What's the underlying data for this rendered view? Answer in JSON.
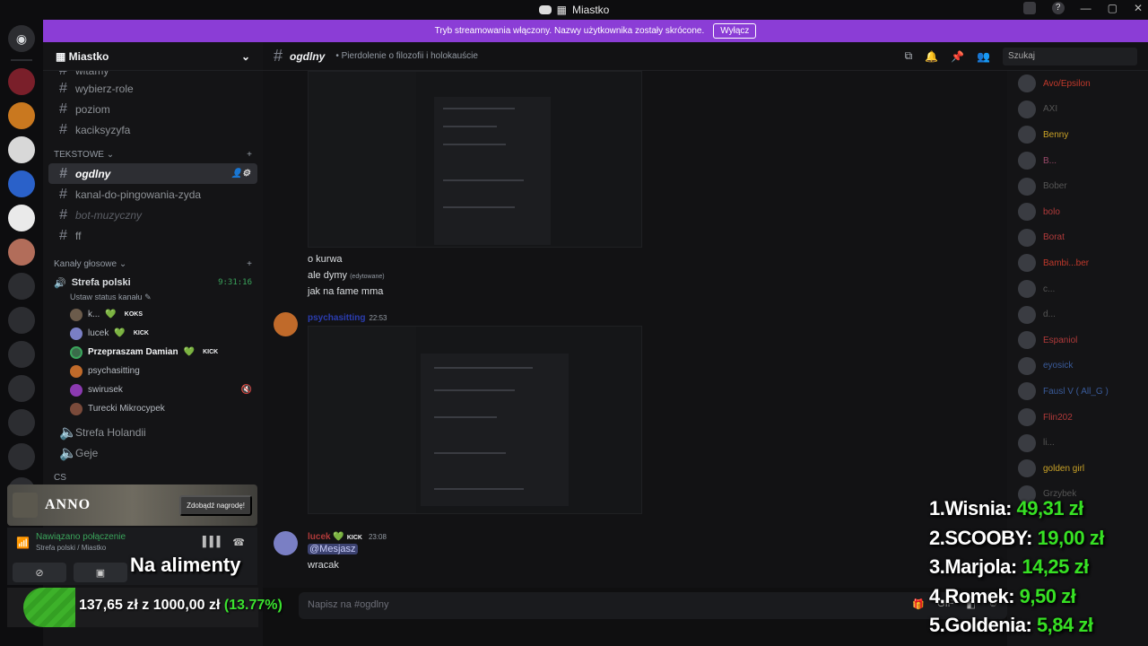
{
  "window": {
    "title": "Miastko",
    "title_icon": "building-icon"
  },
  "banner": {
    "text": "Tryb streamowania włączony. Nazwy użytkownika zostały skrócone.",
    "button": "Wyłącz"
  },
  "guild": {
    "name": "Miastko"
  },
  "channels": [
    {
      "name": "witamy",
      "state": "partial"
    },
    {
      "name": "wybierz-role"
    },
    {
      "name": "poziom"
    },
    {
      "name": "kaciksyzyfa"
    }
  ],
  "categories": {
    "text": "TEKSTOWE",
    "voice": "Kanały głosowe",
    "bottom": "CS"
  },
  "text_channels": [
    {
      "name": "ogdlny",
      "active": true
    },
    {
      "name": "kanal-do-pingowania-zyda"
    },
    {
      "name": "bot-muzyczny",
      "muted": true
    },
    {
      "name": "ff"
    }
  ],
  "voice": {
    "channel": "Strefa polski",
    "timer": "9:31:16",
    "status": "Ustaw status kanału",
    "users": [
      {
        "name": "k...",
        "tag": "KOKS",
        "color": "#6b5b4b"
      },
      {
        "name": "lucek",
        "tag": "KICK",
        "color": "#7a7fc4"
      },
      {
        "name": "Przepraszam Damian",
        "tag": "KICK",
        "bold": true,
        "color": "#3a6b4a"
      },
      {
        "name": "psychasitting",
        "color": "#c06a2a"
      },
      {
        "name": "swirusek",
        "color": "#8b3ab0"
      },
      {
        "name": "Turecki Mikrocypek",
        "color": "#7a4a3a"
      }
    ],
    "other_channels": [
      "Strefa Holandii",
      "Geje"
    ]
  },
  "anno": {
    "logo": "ANNO",
    "button": "Zdobądź nagrodę!"
  },
  "connection": {
    "status": "Nawiązano połączenie",
    "location": "Strefa polski / Miastko"
  },
  "overlay": {
    "alimenty": "Na alimenty",
    "donation_current": "137,65 zł",
    "donation_joiner": "z",
    "donation_goal": "1000,00 zł",
    "donation_pct": "(13.77%)",
    "donation_progress": 0.1377
  },
  "chat": {
    "channel": "ogdlny",
    "topic": "Pierdolenie o filozofii i holokauście",
    "search_placeholder": "Szukaj",
    "messages_block1": [
      "o kurwa",
      "ale dymy",
      "jak na fame mma"
    ],
    "edited_label": "(edytowane)",
    "msg2_author": "psychasitting",
    "msg2_time": "22:53",
    "msg3_author": "lucek",
    "msg3_badge": "KICK",
    "msg3_time": "23:08",
    "msg3_mention": "@Mesjasz",
    "msg3_text": "wracak",
    "composer_placeholder": "Napisz na #ogdlny"
  },
  "members": [
    {
      "name": "Avo/Epsilon",
      "color": "#c0392b"
    },
    {
      "name": "AXI",
      "color": "#555"
    },
    {
      "name": "Benny",
      "color": "#c9a227"
    },
    {
      "name": "B...",
      "color": "#9a4a6a"
    },
    {
      "name": "Bober",
      "color": "#555"
    },
    {
      "name": "bolo",
      "color": "#b03a3a"
    },
    {
      "name": "Borat",
      "color": "#b03a3a"
    },
    {
      "name": "Bambi...ber",
      "color": "#c0392b"
    },
    {
      "name": "c...",
      "color": "#555"
    },
    {
      "name": "d...",
      "color": "#555"
    },
    {
      "name": "Espaniol",
      "color": "#b03a3a"
    },
    {
      "name": "eyosick",
      "color": "#3a5b9a"
    },
    {
      "name": "Fausl V ( All_G )",
      "color": "#3a5b9a"
    },
    {
      "name": "Flin202",
      "color": "#b03a3a"
    },
    {
      "name": "li...",
      "color": "#555"
    },
    {
      "name": "golden girl",
      "color": "#c9a227"
    },
    {
      "name": "Grzybek",
      "color": "#555"
    }
  ],
  "leaderboard": [
    {
      "rank": "1.",
      "name": "Wisnia:",
      "amount": "49,31 zł"
    },
    {
      "rank": "2.",
      "name": "SCOOBY:",
      "amount": "19,00 zł"
    },
    {
      "rank": "3.",
      "name": "Marjola:",
      "amount": "14,25 zł"
    },
    {
      "rank": "4.",
      "name": "Romek:",
      "amount": "9,50 zł"
    },
    {
      "rank": "5.",
      "name": "Goldenia:",
      "amount": "5,84 zł"
    }
  ],
  "colors": {
    "banner": "#8b3dd6",
    "accent_green": "#37e024",
    "background": "#121214"
  }
}
